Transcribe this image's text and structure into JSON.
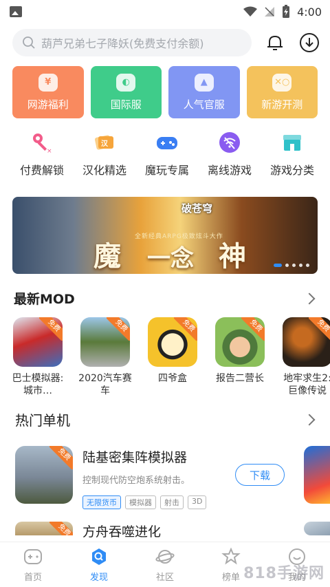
{
  "status_bar": {
    "time": "4:00",
    "icons": [
      "image-icon",
      "wifi-icon",
      "signal-icon",
      "battery-charging-icon"
    ]
  },
  "search": {
    "placeholder": "葫芦兄弟七子降妖(免费支付余额)"
  },
  "tiles": [
    {
      "label": "网游福利",
      "color": "#f98a5f",
      "icon": "money-bag-icon"
    },
    {
      "label": "国际服",
      "color": "#3fcc8a",
      "icon": "globe-icon"
    },
    {
      "label": "人气官服",
      "color": "#8196f3",
      "icon": "fire-icon"
    },
    {
      "label": "新游开测",
      "color": "#f4c25c",
      "icon": "gamepad-icon"
    }
  ],
  "categories": [
    {
      "label": "付费解锁",
      "icon": "key-icon",
      "color": "#f25c8a"
    },
    {
      "label": "汉化精选",
      "icon": "chinese-badge-icon",
      "color": "#f6a53b"
    },
    {
      "label": "魔玩专属",
      "icon": "controller-icon",
      "color": "#3a7ef3"
    },
    {
      "label": "离线游戏",
      "icon": "no-wifi-icon",
      "color": "#8a5cf0"
    },
    {
      "label": "游戏分类",
      "icon": "store-icon",
      "color": "#2fc1c9"
    }
  ],
  "banner": {
    "logo": "破苍穹",
    "tagline": "全新经典ARPG极致炫斗大作",
    "chars": [
      "魔",
      "一念",
      "神"
    ],
    "slides": 5,
    "active_slide": 0
  },
  "latest_mod": {
    "title": "最新MOD",
    "badge": "免费",
    "items": [
      {
        "name": "巴士模拟器:城市…",
        "colors": [
          "#c92a2a",
          "#3b6fbf"
        ]
      },
      {
        "name": "2020汽车赛车",
        "colors": [
          "#5a7a3a",
          "#b0b0b0"
        ]
      },
      {
        "name": "四爷盒",
        "colors": [
          "#f5c22b",
          "#222222"
        ]
      },
      {
        "name": "报告二营长",
        "colors": [
          "#4f7a3c",
          "#8bbf5a"
        ]
      },
      {
        "name": "地牢求生2:巨像传说",
        "colors": [
          "#2a2018",
          "#c56a20"
        ]
      }
    ]
  },
  "hot_single": {
    "title": "热门单机",
    "apps": [
      {
        "title": "陆基密集阵模拟器",
        "desc": "控制现代防空炮系统射击。",
        "tags": [
          "无限货币",
          "模拟器",
          "射击",
          "3D"
        ],
        "button": "下载",
        "badge": "免费"
      },
      {
        "title": "方舟吞噬进化",
        "badge": "免费"
      }
    ]
  },
  "bottom_nav": [
    {
      "label": "首页",
      "icon": "home-gamepad-icon"
    },
    {
      "label": "发现",
      "icon": "discover-icon",
      "active": true
    },
    {
      "label": "社区",
      "icon": "planet-icon"
    },
    {
      "label": "榜单",
      "icon": "ranking-icon"
    },
    {
      "label": "我的",
      "icon": "profile-icon"
    }
  ],
  "watermark": "818手游网"
}
